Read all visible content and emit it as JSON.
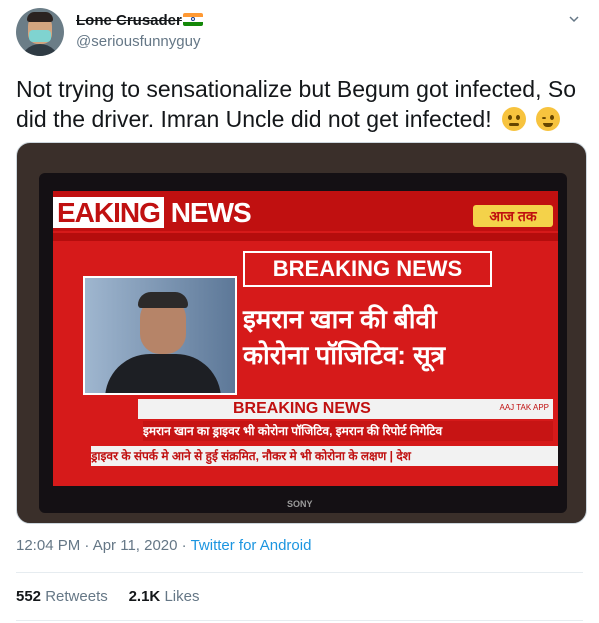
{
  "user": {
    "display_name": "Lone Crusader",
    "handle": "@seriousfunnyguy",
    "flag_icon": "india-flag-icon"
  },
  "tweet": {
    "text": "Not trying to sensationalize but Begum got infected, So did the driver. Imran Uncle did not get infected!",
    "emojis": [
      "thinking-face-icon",
      "winking-face-icon"
    ]
  },
  "media": {
    "headline_left": "EAKING",
    "headline_right": "NEWS",
    "channel_logo": "आज तक",
    "breaking_box": "BREAKING NEWS",
    "hindi_line1": "इमरान खान की बीवी",
    "hindi_line2": "कोरोना पॉजिटिव: सूत्र",
    "bar_label": "BREAKING NEWS",
    "bar_app": "AAJ TAK APP",
    "ticker1": "इमरान खान का ड्राइवर भी कोरोना पॉजिटिव, इमरान की रिपोर्ट निगेटिव",
    "ticker2": "ड्राइवर के संपर्क मे आने से हुई संक्रमित, नौकर मे भी कोरोना के लक्षण | देश",
    "tv_brand": "SONY"
  },
  "meta": {
    "time": "12:04 PM · Apr 11, 2020 · ",
    "source": "Twitter for Android"
  },
  "stats": {
    "retweets_count": "552",
    "retweets_label": "Retweets",
    "likes_count": "2.1K",
    "likes_label": "Likes"
  },
  "colors": {
    "link": "#1b95e0",
    "secondary_text": "#657786"
  }
}
